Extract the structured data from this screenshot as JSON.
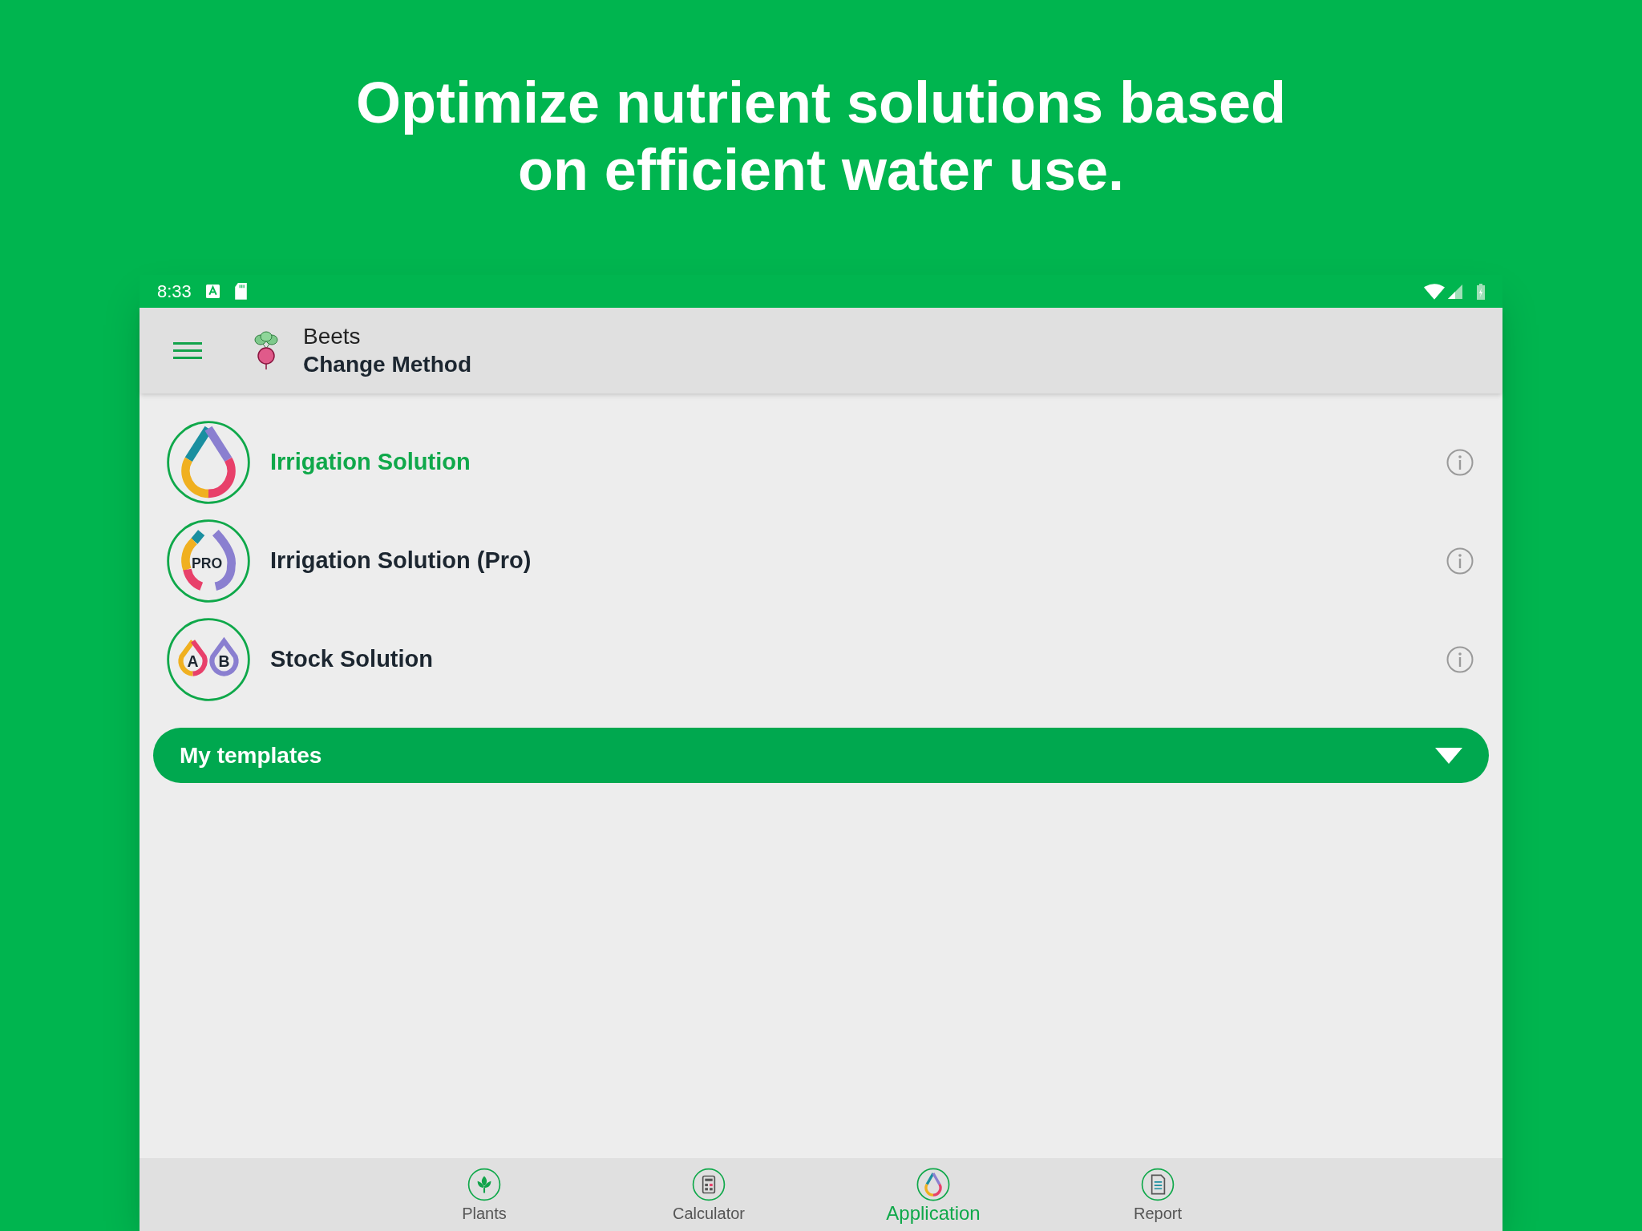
{
  "headline": [
    "Optimize nutrient solutions based",
    "on efficient water use."
  ],
  "status_bar": {
    "time": "8:33"
  },
  "app_bar": {
    "subtitle": "Beets",
    "title": "Change Method"
  },
  "methods": [
    {
      "label": "Irrigation Solution",
      "kind": "drop",
      "selected": true
    },
    {
      "label": "Irrigation Solution (Pro)",
      "kind": "pro",
      "badge": "PRO",
      "selected": false
    },
    {
      "label": "Stock Solution",
      "kind": "ab",
      "letters": [
        "A",
        "B"
      ],
      "selected": false
    }
  ],
  "templates": {
    "label": "My templates",
    "expanded": false
  },
  "nav": [
    {
      "label": "Plants",
      "kind": "plants",
      "selected": false
    },
    {
      "label": "Calculator",
      "kind": "calculator",
      "selected": false
    },
    {
      "label": "Application",
      "kind": "application",
      "selected": true
    },
    {
      "label": "Report",
      "kind": "report",
      "selected": false
    }
  ]
}
